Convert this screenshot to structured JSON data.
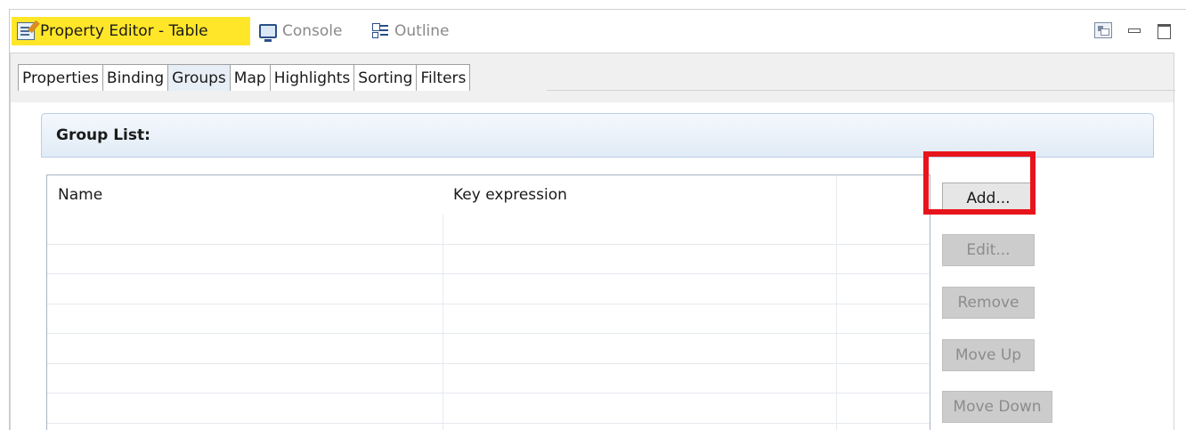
{
  "view_tabs": [
    {
      "label": "Property Editor - Table",
      "icon": "property-editor-icon",
      "active": true
    },
    {
      "label": "Console",
      "icon": "console-icon",
      "active": false
    },
    {
      "label": "Outline",
      "icon": "outline-icon",
      "active": false
    }
  ],
  "view_toolbar": {
    "icons": [
      "view-menu-icon",
      "minimize-icon",
      "maximize-icon"
    ]
  },
  "property_tabs": [
    "Properties",
    "Binding",
    "Groups",
    "Map",
    "Highlights",
    "Sorting",
    "Filters"
  ],
  "selected_property_tab": "Groups",
  "section": {
    "title": "Group List:"
  },
  "table": {
    "columns": [
      "Name",
      "Key expression",
      ""
    ],
    "rows": []
  },
  "buttons": {
    "add": "Add...",
    "edit": "Edit...",
    "remove": "Remove",
    "move_up": "Move Up",
    "move_down": "Move Down"
  },
  "colors": {
    "active_tab_highlight": "#ffe629",
    "annotation_box": "#e8141c",
    "section_header": "#e1ebf6"
  }
}
